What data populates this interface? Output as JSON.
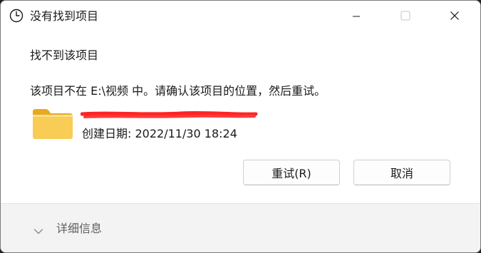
{
  "window": {
    "title": "没有找到项目",
    "title_icon": "clock-icon"
  },
  "caption_buttons": {
    "minimize_icon": "minimize-icon",
    "maximize_icon": "maximize-icon",
    "close_icon": "close-icon"
  },
  "dialog": {
    "heading": "找不到该项目",
    "message": "该项目不在 E:\\视频 中。请确认该项目的位置，然后重试。",
    "item": {
      "icon": "folder-icon",
      "name_redacted": true,
      "date_label": "创建日期: 2022/11/30 18:24"
    },
    "buttons": {
      "retry_label": "重试(R)",
      "cancel_label": "取消"
    }
  },
  "footer": {
    "details_label": "详细信息",
    "details_icon": "chevron-down-icon"
  },
  "colors": {
    "accent_folder": "#f5c54a",
    "redaction": "#ff2a2a",
    "footer_bg": "#f3f3f3"
  }
}
